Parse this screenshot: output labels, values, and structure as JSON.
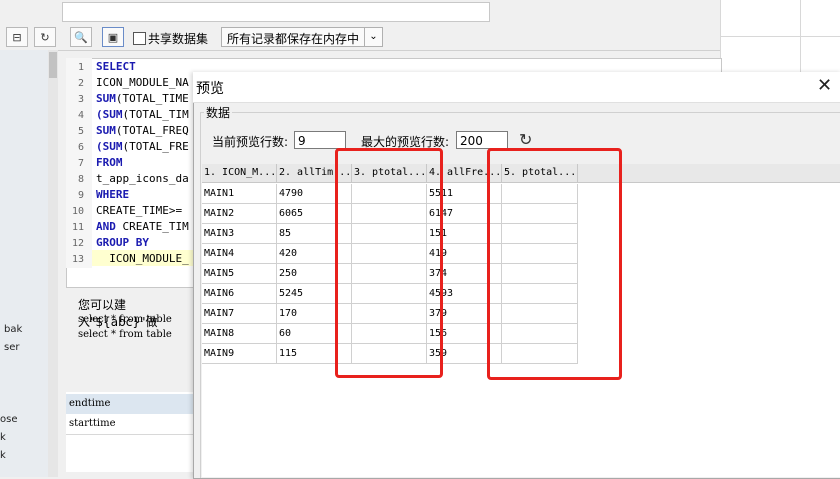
{
  "toolbar": {
    "share_label": "共享数据集",
    "save_mode": "所有记录都保存在内存中"
  },
  "editor": {
    "line_numbers": [
      "1",
      "2",
      "3",
      "4",
      "5",
      "6",
      "7",
      "8",
      "9",
      "10",
      "11",
      "12",
      "13"
    ],
    "lines": [
      {
        "kw": "SELECT",
        "text": ""
      },
      {
        "kw": "",
        "text": "ICON_MODULE_NA"
      },
      {
        "kw": "SUM",
        "text": "(TOTAL_TIME"
      },
      {
        "kw": "(SUM",
        "text": "(TOTAL_TIM"
      },
      {
        "kw": "SUM",
        "text": "(TOTAL_FREQ"
      },
      {
        "kw": "(SUM",
        "text": "(TOTAL_FRE"
      },
      {
        "kw": "FROM",
        "text": ""
      },
      {
        "kw": "",
        "text": "t_app_icons_da"
      },
      {
        "kw": "WHERE",
        "text": ""
      },
      {
        "kw": "",
        "text": "CREATE_TIME>="
      },
      {
        "kw": "AND",
        "text": " CREATE_TIM"
      },
      {
        "kw": "GROUP BY",
        "text": ""
      },
      {
        "kw": "",
        "text": "  ICON_MODULE_"
      }
    ]
  },
  "hint": {
    "line1": "您可以建入\"${abc}\"做",
    "line2": "select * from table",
    "line3": "select * from table"
  },
  "left_pane": [
    "bak",
    "ser",
    "ose",
    "k",
    "k"
  ],
  "bottom_table": [
    "endtime",
    "starttime"
  ],
  "dialog": {
    "title": "预览",
    "group_label": "数据",
    "current_rows_label": "当前预览行数:",
    "current_rows_value": "9",
    "max_rows_label": "最大的预览行数:",
    "max_rows_value": "200",
    "columns": [
      "1. ICON_M...",
      "2. allTim...",
      "3. ptotal...",
      "4. allFre...",
      "5. ptotal..."
    ],
    "rows": [
      [
        "MAIN1",
        "4790",
        "",
        "5511",
        ""
      ],
      [
        "MAIN2",
        "6065",
        "",
        "6147",
        ""
      ],
      [
        "MAIN3",
        "85",
        "",
        "151",
        ""
      ],
      [
        "MAIN4",
        "420",
        "",
        "419",
        ""
      ],
      [
        "MAIN5",
        "250",
        "",
        "374",
        ""
      ],
      [
        "MAIN6",
        "5245",
        "",
        "4593",
        ""
      ],
      [
        "MAIN7",
        "170",
        "",
        "379",
        ""
      ],
      [
        "MAIN8",
        "60",
        "",
        "156",
        ""
      ],
      [
        "MAIN9",
        "115",
        "",
        "359",
        ""
      ]
    ]
  },
  "colors": {
    "highlight_box": "#e8211d",
    "keyword": "#1a1ab0"
  }
}
